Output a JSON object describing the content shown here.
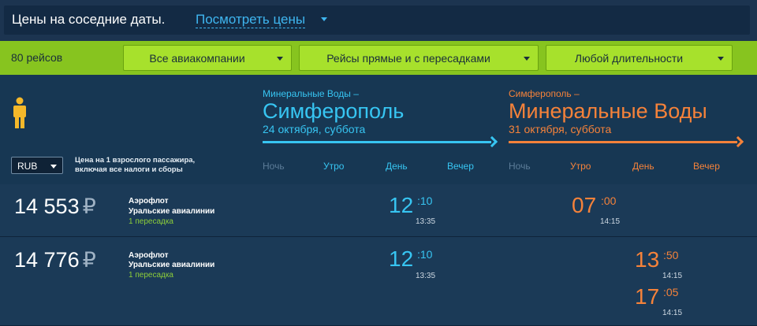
{
  "topbar": {
    "title": "Цены на соседние даты.",
    "link": "Посмотреть цены"
  },
  "filters": {
    "count": "80 рейсов",
    "airlines": "Все авиакомпании",
    "stops": "Рейсы прямые и с пересадками",
    "duration": "Любой длительности"
  },
  "header": {
    "currency": "RUB",
    "price_note": "Цена на 1 взрослого пассажира, включая все налоги и сборы",
    "outbound": {
      "from": "Минеральные Воды –",
      "to": "Симферополь",
      "date": "24 октября, суббота",
      "tod": [
        "Ночь",
        "Утро",
        "День",
        "Вечер"
      ]
    },
    "return": {
      "from": "Симферополь –",
      "to": "Минеральные Воды",
      "date": "31 октября, суббота",
      "tod": [
        "Ночь",
        "Утро",
        "День",
        "Вечер"
      ]
    }
  },
  "colors": {
    "outbound": "#37c5f2",
    "return": "#f5823a",
    "filterbar": "#87c41f",
    "transfer": "#8dce3a"
  },
  "results": [
    {
      "price": "14 553",
      "currency_symbol": "₽",
      "airline1": "Аэрофлот",
      "airline2": "Уральские авиалинии",
      "transfers": "1 пересадка",
      "outbound": {
        "dep_h": "12",
        "dep_m": ":10",
        "arr": "13:35"
      },
      "return": [
        {
          "dep_h": "07",
          "dep_m": ":00",
          "arr": "14:15"
        }
      ]
    },
    {
      "price": "14 776",
      "currency_symbol": "₽",
      "airline1": "Аэрофлот",
      "airline2": "Уральские авиалинии",
      "transfers": "1 пересадка",
      "outbound": {
        "dep_h": "12",
        "dep_m": ":10",
        "arr": "13:35"
      },
      "return": [
        {
          "dep_h": "13",
          "dep_m": ":50",
          "arr": "14:15"
        },
        {
          "dep_h": "17",
          "dep_m": ":05",
          "arr": "14:15"
        }
      ]
    }
  ]
}
